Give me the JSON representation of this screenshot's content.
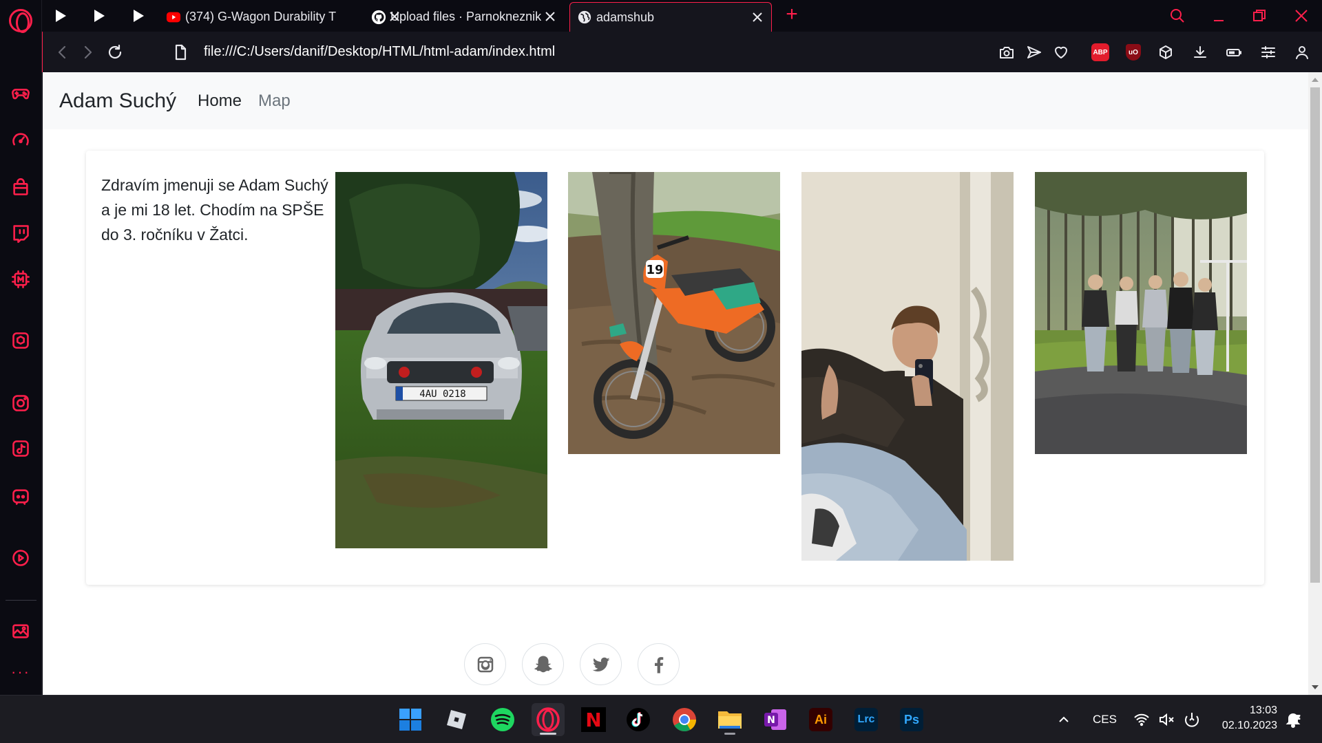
{
  "browser": {
    "tabs": [
      {
        "title": "(374) G-Wagon Durability T",
        "favicon": "youtube-icon"
      },
      {
        "title": "Upload files · Parnokneznik",
        "favicon": "github-icon"
      },
      {
        "title": "adamshub",
        "favicon": "globe-icon",
        "active": true
      }
    ],
    "address": "file:///C:/Users/danif/Desktop/HTML/html-adam/index.html",
    "accent_color": "#ff1f4b",
    "extensions": {
      "abp_label": "ABP",
      "ublock_label": "uO"
    }
  },
  "site": {
    "brand": "Adam Suchý",
    "nav": {
      "home": "Home",
      "map": "Map"
    },
    "intro": "Zdravím jmenuji se Adam Suchý a je mi 18 let. Chodím na SPŠE do 3. ročníku v Žatci.",
    "photos": [
      {
        "name": "car-photo",
        "plate": "4AU 0218"
      },
      {
        "name": "motorcycle-photo",
        "number": "19"
      },
      {
        "name": "mirror-selfie-photo"
      },
      {
        "name": "friends-group-photo"
      }
    ],
    "social": [
      "instagram-icon",
      "snapchat-icon",
      "twitter-icon",
      "facebook-icon"
    ]
  },
  "taskbar": {
    "apps": [
      "windows-start-icon",
      "roblox-icon",
      "spotify-icon",
      "opera-icon",
      "netflix-icon",
      "tiktok-icon",
      "chrome-icon",
      "file-explorer-icon",
      "onenote-icon",
      "illustrator-icon",
      "lightroom-classic-icon",
      "photoshop-icon"
    ],
    "labels": {
      "onenote": "N",
      "illustrator": "Ai",
      "lightroom": "Lrc",
      "photoshop": "Ps",
      "netflix": "N"
    },
    "language": "CES",
    "time": "13:03",
    "date": "02.10.2023"
  }
}
